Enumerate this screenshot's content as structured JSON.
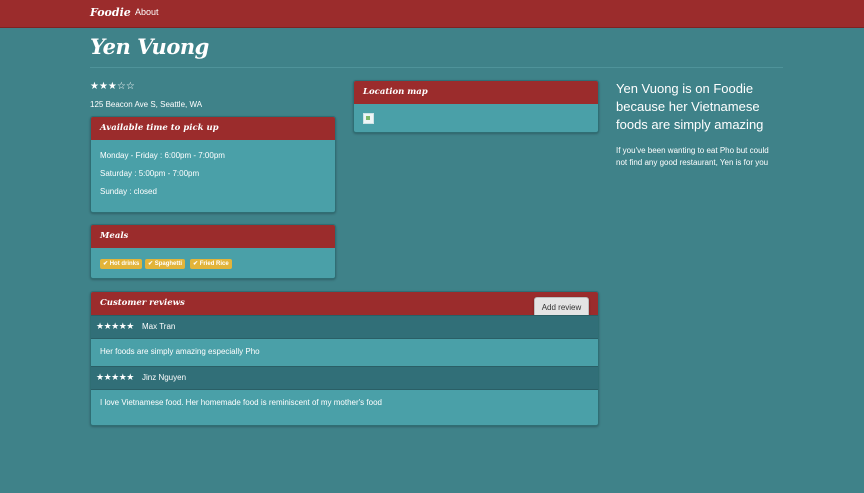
{
  "nav": {
    "brand": "Foodie",
    "links": [
      "About"
    ]
  },
  "page": {
    "title": "Yen Vuong",
    "rating_stars": "★★★☆☆",
    "rating_value": 3,
    "rating_max": 5,
    "address": "125 Beacon Ave S, Seattle, WA"
  },
  "hours": {
    "title": "Available time to pick up",
    "lines": [
      "Monday - Friday : 6:00pm - 7:00pm",
      "Saturday : 5:00pm - 7:00pm",
      "Sunday : closed"
    ]
  },
  "meals": {
    "title": "Meals",
    "tags": [
      "✔ Hot drinks",
      "✔ Spaghetti",
      "✔ Fried Rice"
    ]
  },
  "map": {
    "title": "Location map"
  },
  "side": {
    "heading": "Yen Vuong is on Foodie because her Vietnamese foods are simply amazing",
    "text": "If you've been wanting to eat Pho but could not find any good restaurant, Yen is for you"
  },
  "reviews": {
    "title": "Customer reviews",
    "add_label": "Add review",
    "items": [
      {
        "stars": "★★★★★",
        "name": "Max Tran",
        "text": "Her foods are simply amazing especially Pho"
      },
      {
        "stars": "★★★★★",
        "name": "Jinz Nguyen",
        "text": "I love Vietnamese food. Her homemade food is reminiscent of my mother's food"
      }
    ]
  },
  "colors": {
    "background": "#3f8289",
    "accent_red": "#9b2c2c",
    "panel": "#4aa0a8",
    "tag": "#e2b43a"
  }
}
